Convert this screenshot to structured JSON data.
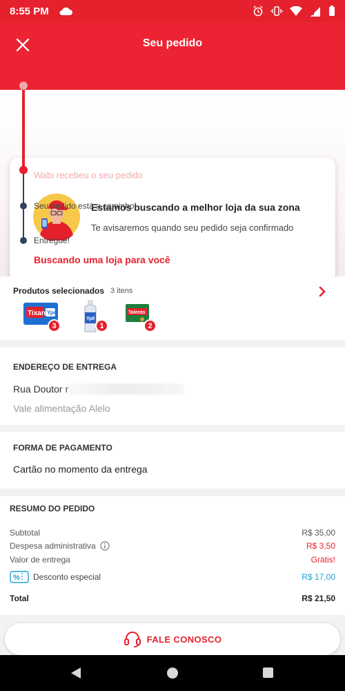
{
  "status_bar": {
    "time": "8:55 PM"
  },
  "header": {
    "title": "Seu pedido"
  },
  "tracking": {
    "step_received": "Wabi recebeu o seu pedido",
    "searching_title": "Estamos buscando a melhor loja da sua zona",
    "searching_subtitle": "Te avisaremos quando seu pedido seja confirmado",
    "step_current": "Buscando uma loja para você",
    "step_on_the_way": "Seu pedido está a caminho!",
    "step_delivered": "Entregue!"
  },
  "products": {
    "title": "Produtos selecionados",
    "count_label": "3 itens",
    "items": [
      {
        "name": "Tixan Ypê",
        "quantity": "3"
      },
      {
        "name": "Ypê",
        "quantity": "1"
      },
      {
        "name": "Talento",
        "quantity": "2"
      }
    ]
  },
  "address": {
    "title": "ENDEREÇO DE ENTREGA",
    "street": "Rua Doutor r",
    "note": "Vale alimentação Alelo"
  },
  "payment": {
    "title": "FORMA DE PAGAMENTO",
    "method": "Cartão no momento da entrega"
  },
  "summary": {
    "title": "RESUMO DO PEDIDO",
    "subtotal_label": "Subtotal",
    "subtotal_value": "R$ 35,00",
    "admin_fee_label": "Despesa administrativa",
    "admin_fee_value": "R$ 3,50",
    "delivery_label": "Valor de entrega",
    "delivery_value": "Grátis!",
    "discount_icon_text": "%",
    "discount_label": "Desconto especial",
    "discount_value": "R$ 17,00",
    "total_label": "Total",
    "total_value": "R$ 21,50"
  },
  "footer": {
    "contact_label": "FALE CONOSCO"
  },
  "colors": {
    "brand_red": "#e5212d",
    "timeline_dark": "#34415f",
    "discount_blue": "#1ba3d6"
  }
}
